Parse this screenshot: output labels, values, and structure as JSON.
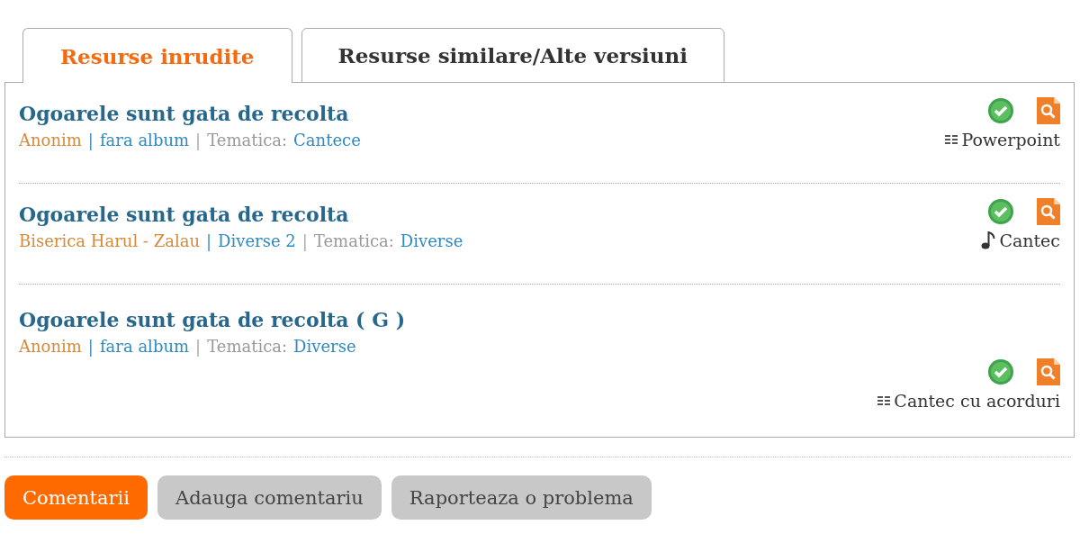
{
  "tabs": [
    {
      "label": "Resurse inrudite",
      "selected": true
    },
    {
      "label": "Resurse similare/Alte versiuni",
      "selected": false
    }
  ],
  "resources": [
    {
      "title": "Ogoarele sunt gata de recolta",
      "meta": [
        {
          "kind": "author",
          "text": "Anonim"
        },
        {
          "kind": "sep",
          "text": "|"
        },
        {
          "kind": "album",
          "text": "fara album"
        },
        {
          "kind": "sep",
          "text": "|"
        },
        {
          "kind": "label",
          "text": "Tematica:"
        },
        {
          "kind": "theme",
          "text": "Cantece"
        }
      ],
      "type": {
        "kind": "lines",
        "label": "Powerpoint"
      }
    },
    {
      "title": "Ogoarele sunt gata de recolta",
      "meta": [
        {
          "kind": "author",
          "text": "Biserica Harul - Zalau"
        },
        {
          "kind": "sep",
          "text": "|"
        },
        {
          "kind": "album",
          "text": "Diverse 2"
        },
        {
          "kind": "sep",
          "text": "|"
        },
        {
          "kind": "label",
          "text": "Tematica:"
        },
        {
          "kind": "theme",
          "text": "Diverse"
        }
      ],
      "type": {
        "kind": "note",
        "label": "Cantec"
      }
    },
    {
      "title": "Ogoarele sunt gata de recolta ( G )",
      "meta": [
        {
          "kind": "author",
          "text": "Anonim"
        },
        {
          "kind": "sep",
          "text": "|"
        },
        {
          "kind": "album",
          "text": "fara album"
        },
        {
          "kind": "sep",
          "text": "|"
        },
        {
          "kind": "label",
          "text": "Tematica:"
        },
        {
          "kind": "theme",
          "text": "Diverse"
        }
      ],
      "type": {
        "kind": "lines",
        "label": "Cantec cu acorduri"
      }
    }
  ],
  "buttons": [
    {
      "label": "Comentarii",
      "selected": true
    },
    {
      "label": "Adauga comentariu",
      "selected": false
    },
    {
      "label": "Raporteaza o problema",
      "selected": false
    }
  ]
}
